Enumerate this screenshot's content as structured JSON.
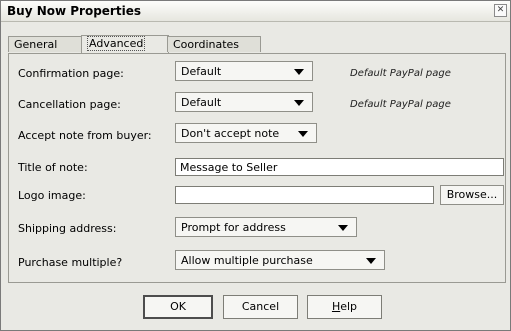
{
  "window": {
    "title": "Buy Now Properties"
  },
  "tabs": [
    {
      "label": "General"
    },
    {
      "label": "Advanced"
    },
    {
      "label": "Coordinates"
    }
  ],
  "fields": {
    "confirmation": {
      "label": "Confirmation page:",
      "value": "Default",
      "note": "Default PayPal page"
    },
    "cancellation": {
      "label": "Cancellation page:",
      "value": "Default",
      "note": "Default PayPal page"
    },
    "accept_note": {
      "label": "Accept note from buyer:",
      "value": "Don't accept note"
    },
    "title_of_note": {
      "label": "Title of note:",
      "value": "Message to Seller"
    },
    "logo_image": {
      "label": "Logo image:",
      "value": "",
      "browse": "Browse..."
    },
    "shipping": {
      "label": "Shipping address:",
      "value": "Prompt for address"
    },
    "purchase_multiple": {
      "label": "Purchase multiple?",
      "value": "Allow multiple purchase"
    }
  },
  "buttons": {
    "ok": "OK",
    "cancel": "Cancel",
    "help_h": "H",
    "help_rest": "elp"
  },
  "icons": {
    "close": "close-icon",
    "dropdown": "dropdown-arrow-icon"
  }
}
